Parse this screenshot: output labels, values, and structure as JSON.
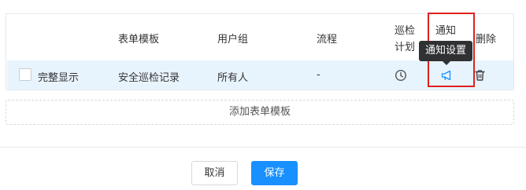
{
  "table": {
    "headers": {
      "form_template": "表单模板",
      "user_group": "用户组",
      "flow": "流程",
      "patrol_plan_line1": "巡检",
      "patrol_plan_line2": "计划",
      "notify_line1": "通知",
      "notify_line2": "设置",
      "delete": "删除"
    },
    "rows": [
      {
        "display_mode": "完整显示",
        "form_template": "安全巡检记录",
        "user_group": "所有人",
        "flow": "-",
        "patrol_plan_icon": "clock-icon",
        "notify_icon": "megaphone-icon",
        "delete_icon": "trash-icon"
      }
    ]
  },
  "tooltip": {
    "text": "通知设置"
  },
  "add_template_label": "添加表单模板",
  "footer": {
    "cancel_label": "取消",
    "save_label": "保存"
  },
  "colors": {
    "accent": "#1890ff",
    "highlight": "#e02020",
    "row_bg": "#e8f4fd",
    "tooltip_bg": "#303133"
  }
}
